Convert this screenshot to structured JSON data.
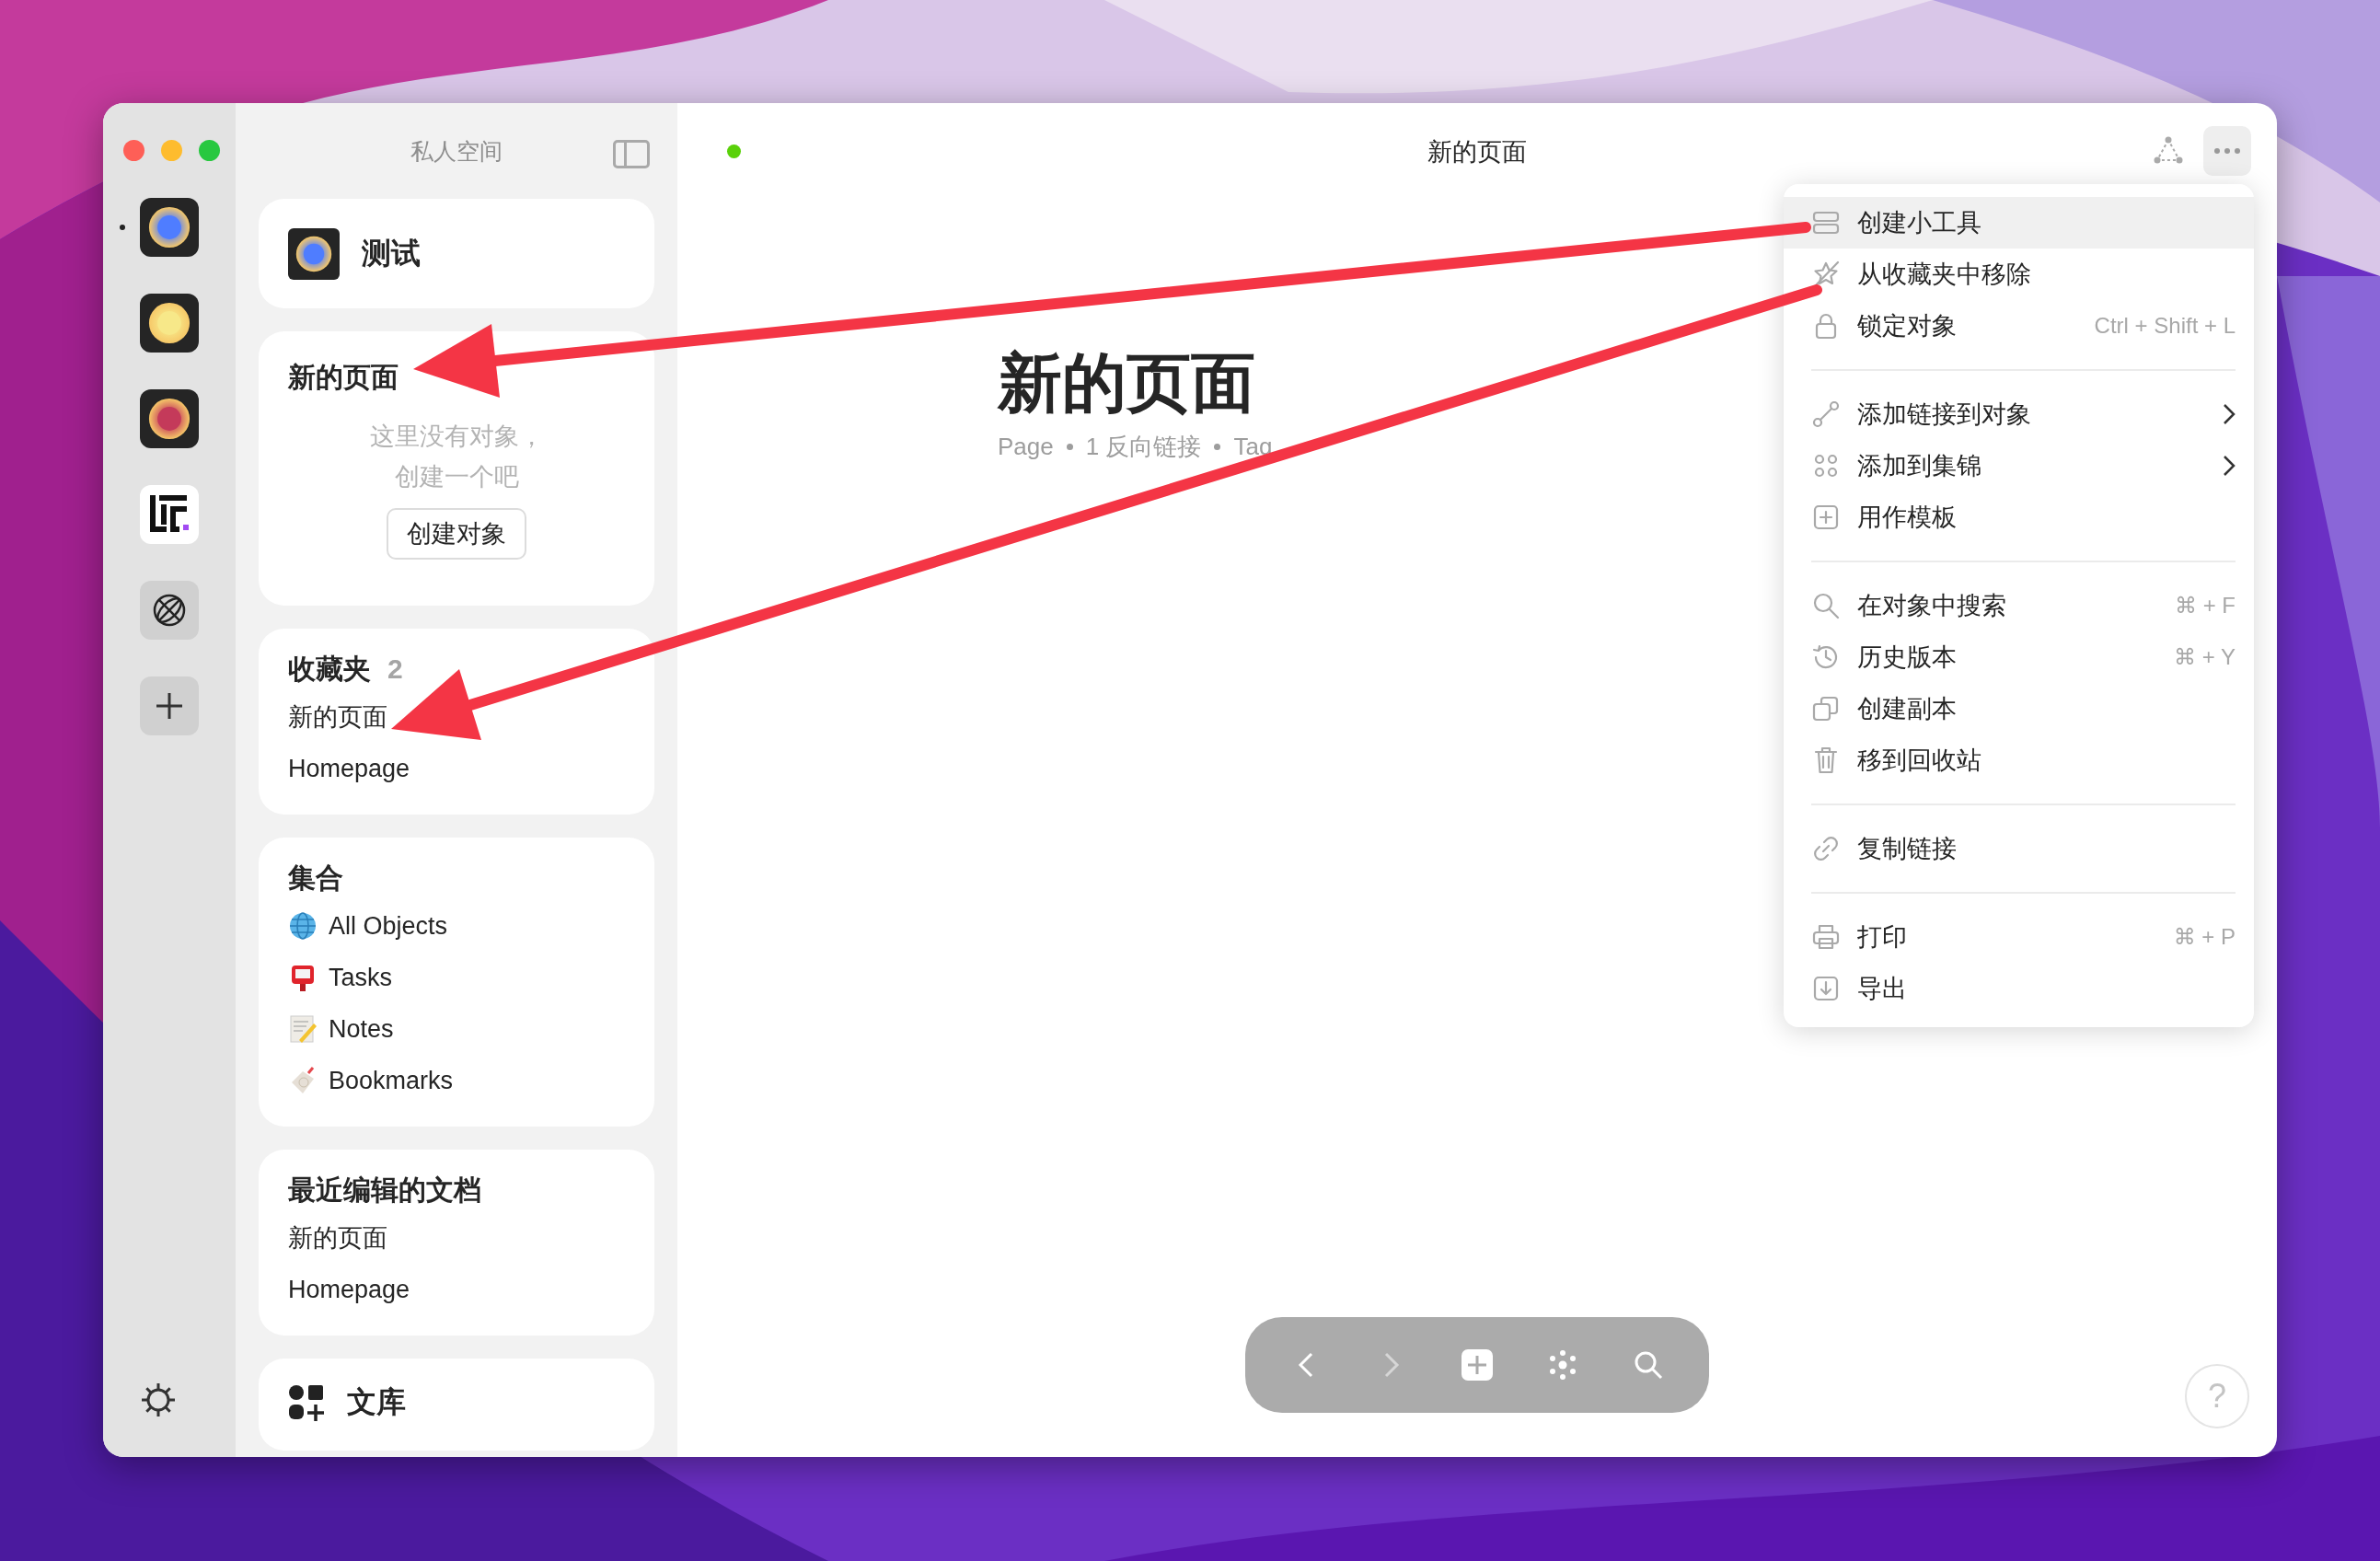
{
  "window": {
    "title": "新的页面"
  },
  "rail": {
    "spaces": [
      {
        "kind": "orb",
        "color": "#4f7dff",
        "selected": true
      },
      {
        "kind": "orb",
        "color": "#f7e889",
        "selected": false
      },
      {
        "kind": "orb",
        "color": "#c43a5a",
        "selected": false
      },
      {
        "kind": "logo",
        "selected": false
      },
      {
        "kind": "globe",
        "selected": false
      },
      {
        "kind": "add",
        "selected": false
      }
    ]
  },
  "sidebar": {
    "title": "私人空间",
    "space_card": {
      "name": "测试"
    },
    "widgets": [
      {
        "kind": "empty",
        "title": "新的页面",
        "message": "这里没有对象，创建一个吧",
        "button": "创建对象"
      },
      {
        "kind": "list",
        "title": "收藏夹",
        "count": "2",
        "items": [
          {
            "label": "新的页面"
          },
          {
            "label": "Homepage"
          }
        ]
      },
      {
        "kind": "list",
        "title": "集合",
        "items": [
          {
            "label": "All Objects",
            "kind": "globe"
          },
          {
            "label": "Tasks",
            "kind": "mailbox"
          },
          {
            "label": "Notes",
            "kind": "memo"
          },
          {
            "label": "Bookmarks",
            "kind": "tag"
          }
        ]
      },
      {
        "kind": "list",
        "title": "最近编辑的文档",
        "items": [
          {
            "label": "新的页面"
          },
          {
            "label": "Homepage"
          }
        ]
      },
      {
        "kind": "library",
        "title": "文库"
      }
    ]
  },
  "page": {
    "title": "新的页面",
    "meta": [
      "Page",
      "1 反向链接",
      "Tag"
    ]
  },
  "menu": {
    "groups": [
      [
        {
          "kind": "widget",
          "label": "创建小工具",
          "selected": true
        },
        {
          "kind": "unstar",
          "label": "从收藏夹中移除",
          "selected": false
        },
        {
          "kind": "lock",
          "label": "锁定对象",
          "shortcut": "Ctrl + Shift + L",
          "selected": false
        }
      ],
      [
        {
          "kind": "relation",
          "label": "添加链接到对象",
          "submenu": true,
          "selected": false
        },
        {
          "kind": "dots",
          "label": "添加到集锦",
          "submenu": true,
          "selected": false
        },
        {
          "kind": "plus",
          "label": "用作模板",
          "selected": false
        }
      ],
      [
        {
          "kind": "search",
          "label": "在对象中搜索",
          "shortcut": "⌘ + F",
          "selected": false
        },
        {
          "kind": "history",
          "label": "历史版本",
          "shortcut": "⌘ + Y",
          "selected": false
        },
        {
          "kind": "copy",
          "label": "创建副本",
          "selected": false
        },
        {
          "kind": "trash",
          "label": "移到回收站",
          "selected": false
        }
      ],
      [
        {
          "kind": "link",
          "label": "复制链接",
          "selected": false
        }
      ],
      [
        {
          "kind": "print",
          "label": "打印",
          "shortcut": "⌘ + P",
          "selected": false
        },
        {
          "kind": "export",
          "label": "导出",
          "selected": false
        }
      ]
    ]
  },
  "toolbar": [
    {
      "kind": "back",
      "disabled": false
    },
    {
      "kind": "forward",
      "disabled": true
    },
    {
      "kind": "add",
      "disabled": false
    },
    {
      "kind": "graph",
      "disabled": false
    },
    {
      "kind": "search",
      "disabled": false
    }
  ],
  "help": "?"
}
